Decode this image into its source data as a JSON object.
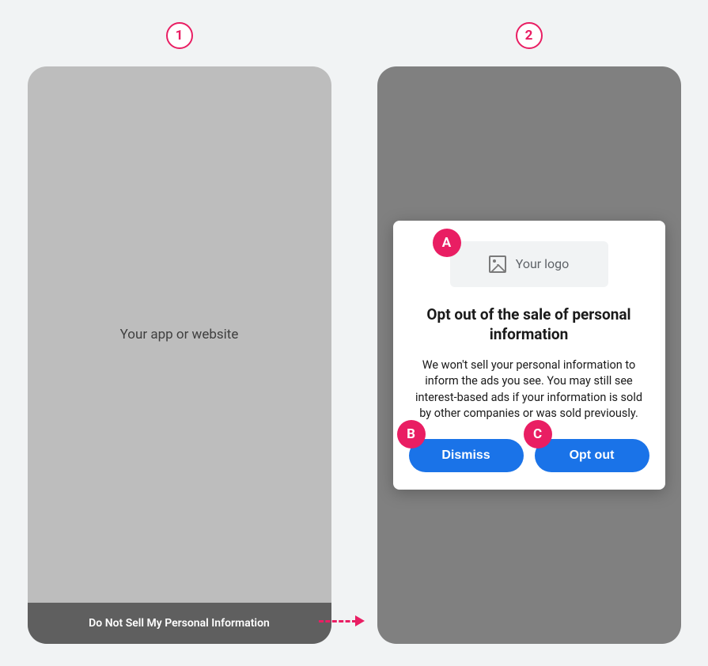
{
  "steps": {
    "one": "1",
    "two": "2"
  },
  "markers": {
    "a": "A",
    "b": "B",
    "c": "C"
  },
  "screen1": {
    "placeholder": "Your app or website",
    "footer_link": "Do Not Sell My Personal Information"
  },
  "screen2": {
    "logo_placeholder": "Your logo",
    "dialog_title": "Opt out of the sale of personal information",
    "dialog_body": "We won't sell your personal information to inform the ads you see. You may still see interest-based ads if your information is sold by other companies or was sold previously.",
    "dismiss_label": "Dismiss",
    "optout_label": "Opt out"
  },
  "colors": {
    "accent": "#e91e63",
    "primary_button": "#1a73e8"
  }
}
